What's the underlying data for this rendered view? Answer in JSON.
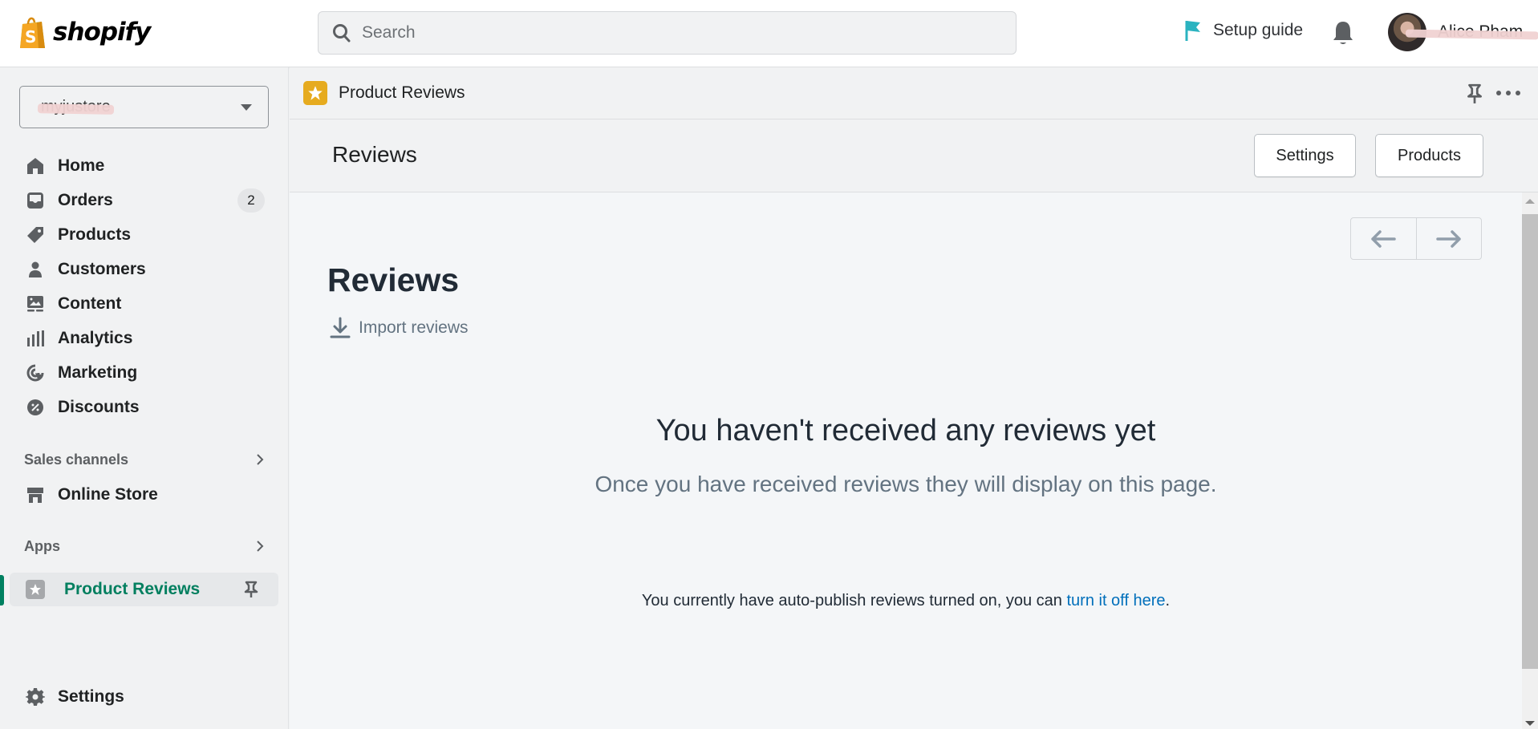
{
  "topbar": {
    "logo_text": "shopify",
    "search_placeholder": "Search",
    "setup_guide_label": "Setup guide",
    "user_name": "Alice Pham"
  },
  "sidebar": {
    "store_name": "myjustore",
    "nav_items": [
      {
        "label": "Home",
        "icon": "home-icon"
      },
      {
        "label": "Orders",
        "icon": "orders-icon",
        "badge": "2"
      },
      {
        "label": "Products",
        "icon": "tag-icon"
      },
      {
        "label": "Customers",
        "icon": "person-icon"
      },
      {
        "label": "Content",
        "icon": "image-icon"
      },
      {
        "label": "Analytics",
        "icon": "bar-chart-icon"
      },
      {
        "label": "Marketing",
        "icon": "target-icon"
      },
      {
        "label": "Discounts",
        "icon": "discount-icon"
      }
    ],
    "sales_channels_label": "Sales channels",
    "online_store_label": "Online Store",
    "apps_label": "Apps",
    "active_app_label": "Product Reviews",
    "settings_label": "Settings"
  },
  "appbar": {
    "title": "Product Reviews"
  },
  "titlebar": {
    "title": "Reviews",
    "settings_button": "Settings",
    "products_button": "Products"
  },
  "content": {
    "heading": "Reviews",
    "import_label": "Import reviews",
    "empty_title": "You haven't received any reviews yet",
    "empty_subtitle": "Once you have received reviews they will display on this page.",
    "note_prefix": "You currently have auto-publish reviews turned on, you can ",
    "note_link": "turn it off here",
    "note_suffix": "."
  },
  "colors": {
    "brand_green": "#008060",
    "active_text": "#007f5f",
    "app_icon": "#e6ab1f",
    "link": "#006fbb",
    "setup_flag": "#2bb3c0"
  }
}
